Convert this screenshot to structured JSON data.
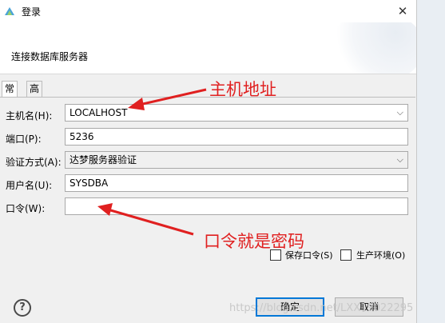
{
  "window": {
    "title": "登录",
    "close_glyph": "✕"
  },
  "banner": {
    "text": "连接数据库服务器"
  },
  "tabs": [
    {
      "label": "常规",
      "active": true
    },
    {
      "label": "高级",
      "active": false
    }
  ],
  "form": {
    "host": {
      "label": "主机名(H):",
      "value": "LOCALHOST"
    },
    "port": {
      "label": "端口(P):",
      "value": "5236"
    },
    "auth": {
      "label": "验证方式(A):",
      "value": "达梦服务器验证"
    },
    "user": {
      "label": "用户名(U):",
      "value": "SYSDBA"
    },
    "password": {
      "label": "口令(W):",
      "value": ""
    }
  },
  "options": {
    "save_password": {
      "label": "保存口令(S)",
      "checked": false
    },
    "production": {
      "label": "生产环境(O)",
      "checked": false
    }
  },
  "buttons": {
    "help": "?",
    "ok": "确定",
    "cancel": "取消"
  },
  "annotations": {
    "host_note": "主机地址",
    "password_note": "口令就是密码",
    "color": "#e02020"
  },
  "watermark": "https://blog.csdn.net/LXX19022295"
}
